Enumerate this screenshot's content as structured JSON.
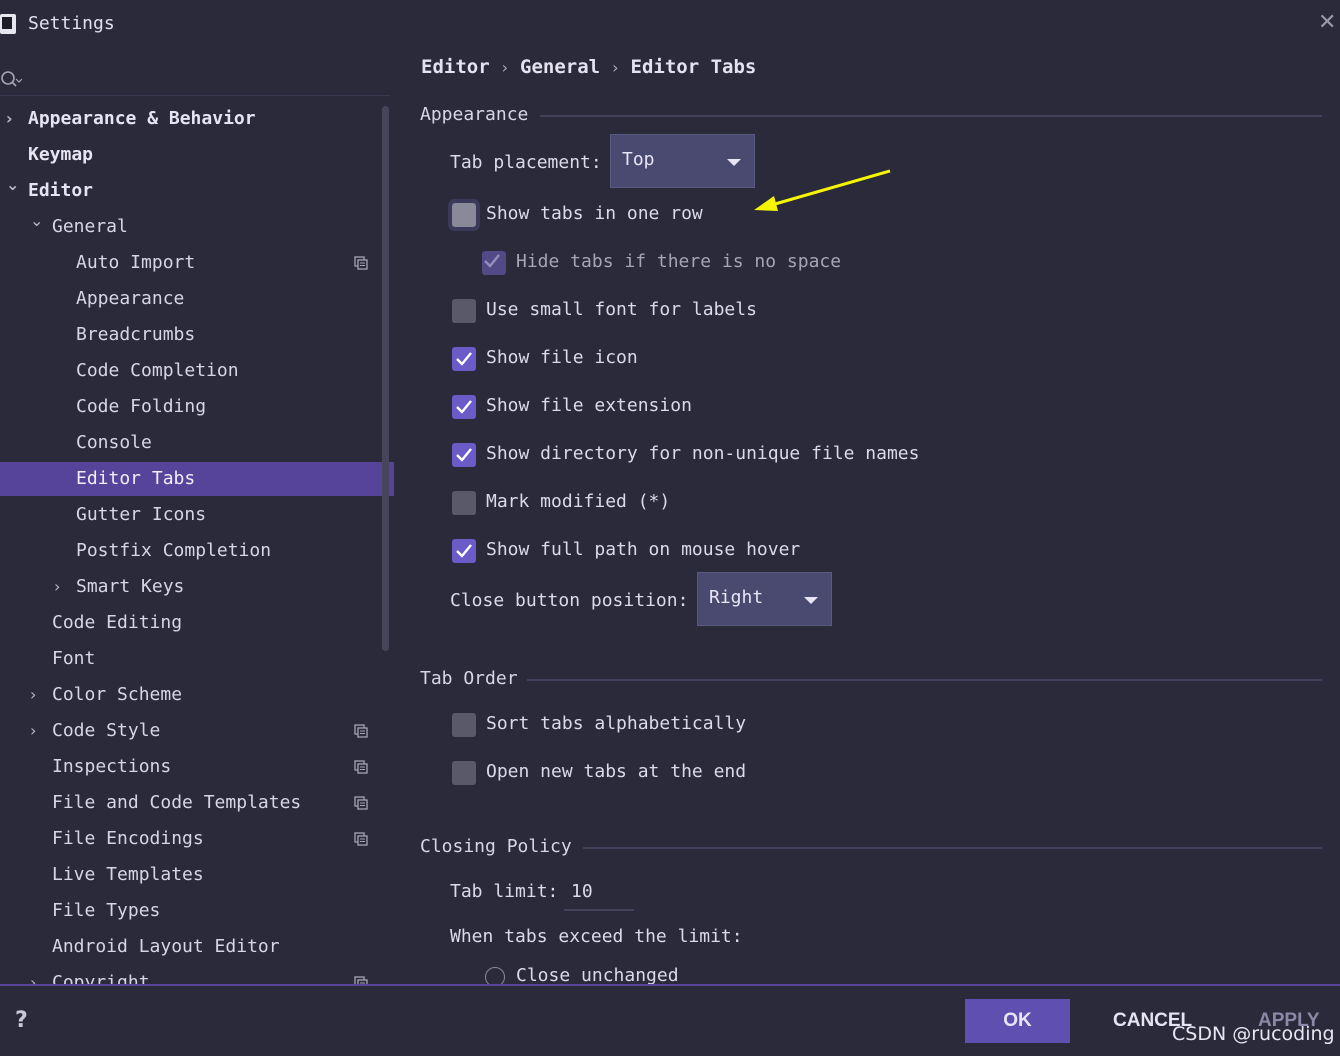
{
  "window": {
    "title": "Settings"
  },
  "sidebar": {
    "items": [
      {
        "label": "Appearance & Behavior",
        "level": 0,
        "chevron": "right",
        "bold": true
      },
      {
        "label": "Keymap",
        "level": 0,
        "chevron": "",
        "bold": true
      },
      {
        "label": "Editor",
        "level": 0,
        "chevron": "down",
        "bold": true
      },
      {
        "label": "General",
        "level": 1,
        "chevron": "down"
      },
      {
        "label": "Auto Import",
        "level": 2,
        "chevron": "",
        "project": true
      },
      {
        "label": "Appearance",
        "level": 2,
        "chevron": ""
      },
      {
        "label": "Breadcrumbs",
        "level": 2,
        "chevron": ""
      },
      {
        "label": "Code Completion",
        "level": 2,
        "chevron": ""
      },
      {
        "label": "Code Folding",
        "level": 2,
        "chevron": ""
      },
      {
        "label": "Console",
        "level": 2,
        "chevron": ""
      },
      {
        "label": "Editor Tabs",
        "level": 2,
        "chevron": "",
        "selected": true
      },
      {
        "label": "Gutter Icons",
        "level": 2,
        "chevron": ""
      },
      {
        "label": "Postfix Completion",
        "level": 2,
        "chevron": ""
      },
      {
        "label": "Smart Keys",
        "level": 2,
        "chevron": "right"
      },
      {
        "label": "Code Editing",
        "level": 1,
        "chevron": ""
      },
      {
        "label": "Font",
        "level": 1,
        "chevron": ""
      },
      {
        "label": "Color Scheme",
        "level": 1,
        "chevron": "right"
      },
      {
        "label": "Code Style",
        "level": 1,
        "chevron": "right",
        "project": true
      },
      {
        "label": "Inspections",
        "level": 1,
        "chevron": "",
        "project": true
      },
      {
        "label": "File and Code Templates",
        "level": 1,
        "chevron": "",
        "project": true
      },
      {
        "label": "File Encodings",
        "level": 1,
        "chevron": "",
        "project": true
      },
      {
        "label": "Live Templates",
        "level": 1,
        "chevron": ""
      },
      {
        "label": "File Types",
        "level": 1,
        "chevron": ""
      },
      {
        "label": "Android Layout Editor",
        "level": 1,
        "chevron": ""
      },
      {
        "label": "Copyright",
        "level": 1,
        "chevron": "right",
        "project": true
      }
    ]
  },
  "breadcrumb": [
    "Editor",
    "General",
    "Editor Tabs"
  ],
  "appearance": {
    "title": "Appearance",
    "tab_placement_label": "Tab placement:",
    "tab_placement_value": "Top",
    "checkboxes": [
      {
        "label": "Show tabs in one row",
        "checked": false,
        "focused": true
      },
      {
        "label": "Hide tabs if there is no space",
        "checked": true,
        "disabled": true
      },
      {
        "label": "Use small font for labels",
        "checked": false
      },
      {
        "label": "Show file icon",
        "checked": true
      },
      {
        "label": "Show file extension",
        "checked": true
      },
      {
        "label": "Show directory for non-unique file names",
        "checked": true
      },
      {
        "label": "Mark modified (*)",
        "checked": false
      },
      {
        "label": "Show full path on mouse hover",
        "checked": true
      }
    ],
    "close_button_label": "Close button position:",
    "close_button_value": "Right"
  },
  "tab_order": {
    "title": "Tab Order",
    "checkboxes": [
      {
        "label": "Sort tabs alphabetically",
        "checked": false
      },
      {
        "label": "Open new tabs at the end",
        "checked": false
      }
    ]
  },
  "closing_policy": {
    "title": "Closing Policy",
    "tab_limit_label": "Tab limit:",
    "tab_limit_value": "10",
    "exceed_label": "When tabs exceed the limit:",
    "radio_close_unchanged": "Close unchanged"
  },
  "footer": {
    "help": "?",
    "ok": "OK",
    "cancel": "CANCEL",
    "apply": "APPLY",
    "watermark": "CSDN @rucoding"
  },
  "colors": {
    "background": "#2b2a3a",
    "selection": "#56449a",
    "checkbox_checked": "#6b5bc9",
    "annotation_arrow": "#f5f500"
  }
}
